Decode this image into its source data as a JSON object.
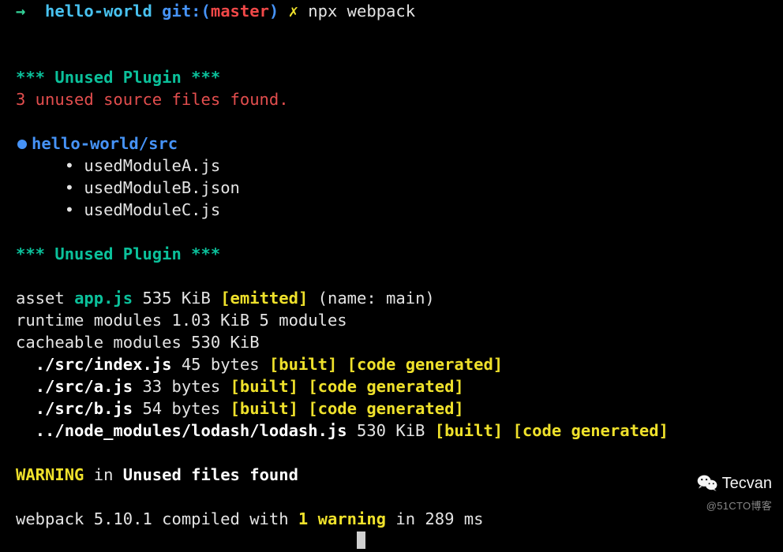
{
  "prompt": {
    "arrow": "→",
    "dir": "hello-world",
    "git_prefix": "git:",
    "gp_open": "(",
    "branch": "master",
    "gp_close": ")",
    "dirty": "✗",
    "command": "npx webpack"
  },
  "plugin_header1": "*** Unused Plugin ***",
  "unused_msg": "3 unused source files found.",
  "src_path": "hello-world/src",
  "files": [
    "usedModuleA.js",
    "usedModuleB.json",
    "usedModuleC.js"
  ],
  "plugin_header2": "*** Unused Plugin ***",
  "asset": {
    "prefix": "asset",
    "name": "app.js",
    "size": "535 KiB",
    "badge": "[emitted]",
    "suffix": "(name: main)"
  },
  "runtime": "runtime modules 1.03 KiB 5 modules",
  "cacheable": "cacheable modules 530 KiB",
  "modules": [
    {
      "path": "./src/index.js",
      "size": "45 bytes",
      "badge": "[built] [code generated]"
    },
    {
      "path": "./src/a.js",
      "size": "33 bytes",
      "badge": "[built] [code generated]"
    },
    {
      "path": "./src/b.js",
      "size": "54 bytes",
      "badge": "[built] [code generated]"
    },
    {
      "path": "../node_modules/lodash/lodash.js",
      "size": "530 KiB",
      "badge": "[built] [code generated]"
    }
  ],
  "warning": {
    "label": "WARNING",
    "in": "in",
    "msg": "Unused files found"
  },
  "summary": {
    "pre": "webpack 5.10.1 compiled with",
    "warn": "1 warning",
    "post": "in 289 ms"
  },
  "watermark": {
    "brand": "Tecvan",
    "sub": "@51CTO博客"
  }
}
